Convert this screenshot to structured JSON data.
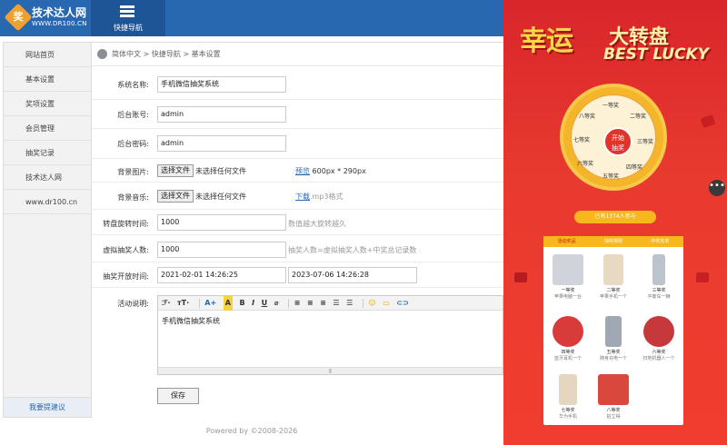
{
  "header": {
    "logo_mark": "奖",
    "logo_title": "技术达人网",
    "logo_sub": "WWW.DR100.CN",
    "nav_label": "快捷导航"
  },
  "sidebar": {
    "items": [
      "网站首页",
      "基本设置",
      "奖项设置",
      "会员管理",
      "抽奖记录",
      "技术达人网",
      "www.dr100.cn"
    ],
    "bottom": "我要提建议"
  },
  "breadcrumb": "简体中文 > 快捷导航 > 基本设置",
  "form": {
    "system_name": {
      "label": "系统名称:",
      "value": "手机微信抽奖系统"
    },
    "admin_account": {
      "label": "后台账号:",
      "value": "admin"
    },
    "admin_password": {
      "label": "后台密码:",
      "value": "admin"
    },
    "bg_image": {
      "label": "背景图片:",
      "button": "选择文件",
      "none": "未选择任何文件",
      "link": "预览",
      "hint": "600px * 290px"
    },
    "bg_music": {
      "label": "背景音乐:",
      "button": "选择文件",
      "none": "未选择任何文件",
      "link": "下载",
      "hint": ".mp3格式"
    },
    "spin_time": {
      "label": "转盘旋转时间:",
      "value": "1000",
      "hint": "数值越大旋转越久"
    },
    "virtual_count": {
      "label": "虚拟抽奖人数:",
      "value": "1000",
      "hint": "抽奖人数=虚拟抽奖人数+中奖总记录数"
    },
    "open_time": {
      "label": "抽奖开放时间:",
      "start": "2021-02-01 14:26:25",
      "end": "2023-07-06 14:26:28"
    },
    "description": {
      "label": "活动说明:",
      "content": "手机微信抽奖系统"
    },
    "save": "保存"
  },
  "editor_toolbar": [
    "ℱ·",
    "ᴛT·",
    "A+",
    "A",
    "B",
    "I",
    "U",
    "⌀",
    "≡",
    "≡",
    "≡",
    "☰",
    "☰",
    "☺",
    "▭",
    "⊂⊃"
  ],
  "footer": "Powered by ©2008-2026",
  "promo": {
    "title_cn1": "幸运",
    "title_cn2": "大转盘",
    "title_en": "BEST LUCKY",
    "center": "开始\n抽奖",
    "bar": "已有1374人参与",
    "tabs": [
      "活动奖品",
      "抽奖规则",
      "中奖名单"
    ],
    "prizes": [
      {
        "name": "一等奖",
        "desc": "苹果电脑一台"
      },
      {
        "name": "二等奖",
        "desc": "苹果手机一个"
      },
      {
        "name": "三等奖",
        "desc": "平衡车一辆"
      },
      {
        "name": "四等奖",
        "desc": "蓝牙耳机一个"
      },
      {
        "name": "五等奖",
        "desc": "随身充电一个"
      },
      {
        "name": "六等奖",
        "desc": "扫地机器人一个"
      },
      {
        "name": "七等奖",
        "desc": "华为手机"
      },
      {
        "name": "八等奖",
        "desc": "拍立得"
      }
    ],
    "more": "•••"
  }
}
